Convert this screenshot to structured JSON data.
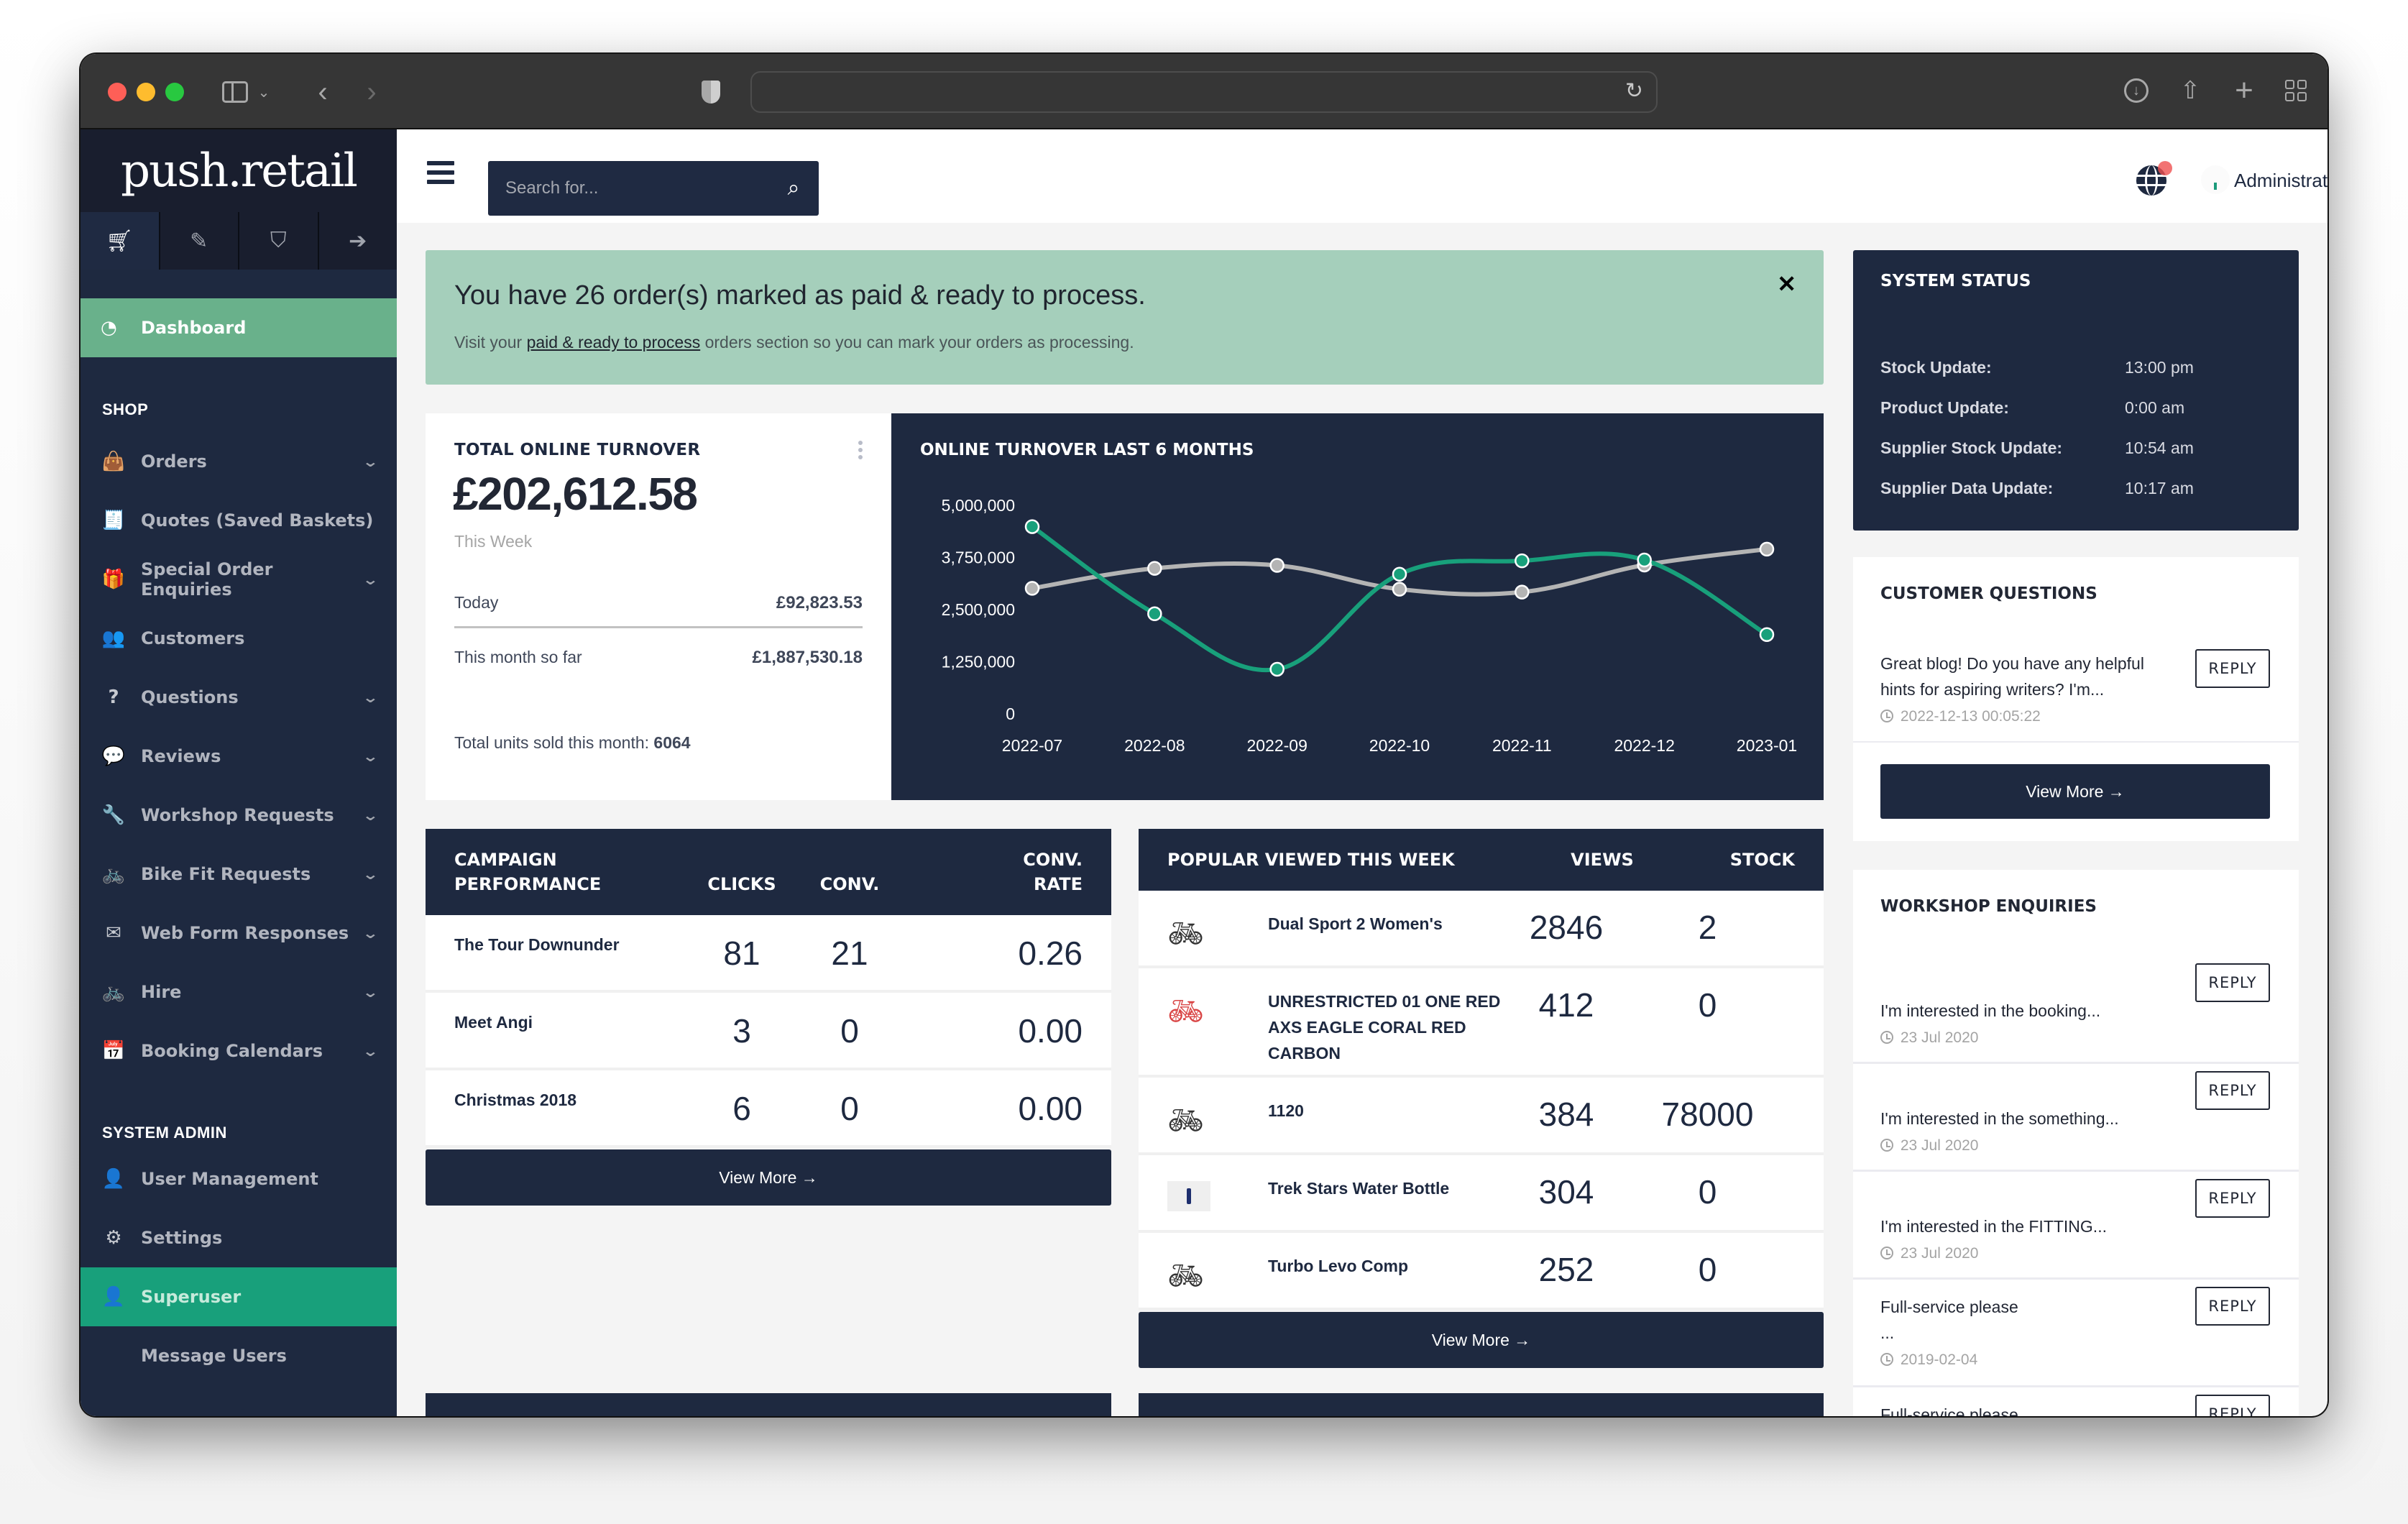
{
  "browser": {
    "url": "",
    "buttons": [
      "sidebar-toggle",
      "back",
      "forward",
      "downloads",
      "share",
      "new-tab",
      "tab-overview"
    ]
  },
  "brand": {
    "logo_text": "push.retail"
  },
  "sidebar": {
    "tabs": [
      {
        "icon": "cart-icon",
        "glyph": "🛒",
        "active": true
      },
      {
        "icon": "pencil-icon",
        "glyph": "✎",
        "active": false
      },
      {
        "icon": "tags-icon",
        "glyph": "🏷",
        "active": false
      },
      {
        "icon": "sign-out-icon",
        "glyph": "➜",
        "active": false
      }
    ],
    "active_item": {
      "label": "Dashboard",
      "icon": "dashboard-icon",
      "glyph": "◔"
    },
    "sections": [
      {
        "title": "SHOP",
        "items": [
          {
            "label": "Orders",
            "icon": "shopping-bag-icon",
            "glyph": "👜",
            "expandable": true
          },
          {
            "label": "Quotes (Saved Baskets)",
            "icon": "receipt-icon",
            "glyph": "🧾",
            "expandable": false
          },
          {
            "label": "Special Order Enquiries",
            "icon": "gift-icon",
            "glyph": "🎁",
            "expandable": true
          },
          {
            "label": "Customers",
            "icon": "users-icon",
            "glyph": "👥",
            "expandable": false
          },
          {
            "label": "Questions",
            "icon": "question-circle-icon",
            "glyph": "?",
            "expandable": true
          },
          {
            "label": "Reviews",
            "icon": "comments-icon",
            "glyph": "💬",
            "expandable": true
          },
          {
            "label": "Workshop Requests",
            "icon": "wrench-icon",
            "glyph": "🔧",
            "expandable": true
          },
          {
            "label": "Bike Fit Requests",
            "icon": "bicycle-icon",
            "glyph": "🚲",
            "expandable": true
          },
          {
            "label": "Web Form Responses",
            "icon": "envelope-open-icon",
            "glyph": "✉",
            "expandable": true
          },
          {
            "label": "Hire",
            "icon": "bicycle-icon",
            "glyph": "🚲",
            "expandable": true
          },
          {
            "label": "Booking Calendars",
            "icon": "calendar-icon",
            "glyph": "📅",
            "expandable": true
          }
        ]
      },
      {
        "title": "SYSTEM ADMIN",
        "items": [
          {
            "label": "User Management",
            "icon": "user-astronaut-icon",
            "glyph": "👤"
          },
          {
            "label": "Settings",
            "icon": "gear-icon",
            "glyph": "⚙"
          },
          {
            "label": "Superuser",
            "icon": "user-shield-icon",
            "glyph": "👤",
            "highlighted": true
          },
          {
            "label": "Message Users",
            "icon": "",
            "glyph": ""
          }
        ]
      }
    ]
  },
  "header": {
    "search_placeholder": "Search for...",
    "search_value": "",
    "user_name": "Administrator",
    "notification_badge": true
  },
  "alert": {
    "title": "You have 26 order(s) marked as paid & ready to process.",
    "text_before": "Visit your ",
    "link_text": "paid & ready to process",
    "text_after": " orders section so you can mark your orders as processing.",
    "close": "×"
  },
  "turnover": {
    "title": "TOTAL ONLINE TURNOVER",
    "amount": "£202,612.58",
    "period": "This Week",
    "today_label": "Today",
    "today_value": "£92,823.53",
    "month_label": "This month so far",
    "month_value": "£1,887,530.18",
    "units_label": "Total units sold this month: ",
    "units_value": "6064"
  },
  "chart_data": {
    "type": "line",
    "title": "ONLINE TURNOVER LAST 6 MONTHS",
    "categories": [
      "2022-07",
      "2022-08",
      "2022-09",
      "2022-10",
      "2022-11",
      "2022-12",
      "2023-01"
    ],
    "series": [
      {
        "name": "Series A (green)",
        "color": "#18a07b",
        "values": [
          4490000,
          2400000,
          1070000,
          3350000,
          3670000,
          3690000,
          1900000
        ]
      },
      {
        "name": "Series B (grey)",
        "color": "#b4b4b4",
        "values": [
          3010000,
          3490000,
          3560000,
          2990000,
          2920000,
          3570000,
          3950000
        ]
      }
    ],
    "yticks": [
      "5,000,000",
      "3,750,000",
      "2,500,000",
      "1,250,000",
      "0"
    ],
    "ytick_values": [
      5000000,
      3750000,
      2500000,
      1250000,
      0
    ],
    "ylim": [
      0,
      5000000
    ],
    "xlabel": "",
    "ylabel": "",
    "grid": false,
    "smooth": true
  },
  "campaigns": {
    "headers": {
      "name_line1": "CAMPAIGN",
      "name_line2": "PERFORMANCE",
      "clicks": "CLICKS",
      "conv": "CONV.",
      "rate_line1": "CONV.",
      "rate_line2": "RATE"
    },
    "rows": [
      {
        "name": "The Tour Downunder",
        "clicks": "81",
        "conv": "21",
        "rate": "0.26"
      },
      {
        "name": "Meet Angi",
        "clicks": "3",
        "conv": "0",
        "rate": "0.00"
      },
      {
        "name": "Christmas 2018",
        "clicks": "6",
        "conv": "0",
        "rate": "0.00"
      }
    ],
    "view_more": "View More →"
  },
  "popular": {
    "headers": {
      "name": "POPULAR VIEWED THIS WEEK",
      "views": "VIEWS",
      "stock": "STOCK"
    },
    "rows": [
      {
        "name": "Dual Sport 2 Women's",
        "views": "2846",
        "stock": "2",
        "thumb": "bike"
      },
      {
        "name": "UNRESTRICTED 01 ONE RED AXS EAGLE CORAL RED CARBON",
        "views": "412",
        "stock": "0",
        "thumb": "bike-red"
      },
      {
        "name": "1120",
        "views": "384",
        "stock": "78000",
        "thumb": "bike"
      },
      {
        "name": "Trek Stars Water Bottle",
        "views": "304",
        "stock": "0",
        "thumb": "bottle"
      },
      {
        "name": "Turbo Levo Comp",
        "views": "252",
        "stock": "0",
        "thumb": "bike"
      }
    ],
    "view_more": "View More →"
  },
  "system_status": {
    "title": "SYSTEM STATUS",
    "rows": [
      {
        "label": "Stock Update:",
        "value": "13:00 pm"
      },
      {
        "label": "Product Update:",
        "value": "0:00 am"
      },
      {
        "label": "Supplier Stock Update:",
        "value": "10:54 am"
      },
      {
        "label": "Supplier Data Update:",
        "value": "10:17 am"
      }
    ]
  },
  "customer_questions": {
    "title": "CUSTOMER QUESTIONS",
    "items": [
      {
        "text": "Great blog! Do you have any helpful hints for aspiring writers? I'm...",
        "date": "2022-12-13 00:05:22",
        "reply": "REPLY"
      }
    ],
    "view_more": "View More →"
  },
  "workshop_enquiries": {
    "title": "WORKSHOP ENQUIRIES",
    "items": [
      {
        "text": "I'm interested in the booking...",
        "date": "23 Jul 2020",
        "reply": "REPLY"
      },
      {
        "text": "I'm interested in the something...",
        "date": "23 Jul 2020",
        "reply": "REPLY"
      },
      {
        "text": "I'm interested in the FITTING...",
        "date": "23 Jul 2020",
        "reply": "REPLY"
      },
      {
        "text": "Full-service please",
        "text2": "...",
        "date": "2019-02-04",
        "reply": "REPLY"
      },
      {
        "text": "Full-service please",
        "date": "",
        "reply": "REPLY"
      }
    ]
  }
}
